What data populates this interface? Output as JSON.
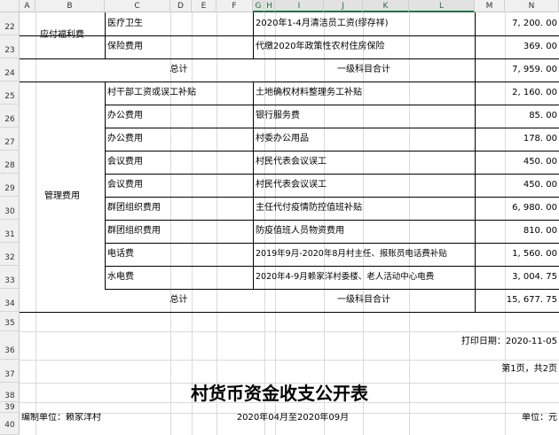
{
  "sheet": {
    "columns": [
      "A",
      "B",
      "C",
      "D",
      "E",
      "F",
      "G",
      "H",
      "I",
      "J",
      "K",
      "L",
      "M",
      "N"
    ],
    "rows": [
      "22",
      "23",
      "24",
      "25",
      "26",
      "27",
      "28",
      "29",
      "30",
      "31",
      "32",
      "33",
      "34",
      "35",
      "36",
      "37",
      "38",
      "39",
      "40"
    ]
  },
  "group1": {
    "category": "应付福利费",
    "items": [
      {
        "subject": "医疗卫生",
        "desc": "2020年1-4月清洁员工资(缪存祥)",
        "amount": "7, 200. 00"
      },
      {
        "subject": "保险费用",
        "desc": "代缴2020年政策性农村住房保险",
        "amount": "369. 00"
      }
    ],
    "total_label": "总计",
    "subtotal_label": "一级科目合计",
    "total_amount": "7, 959. 00"
  },
  "group2": {
    "category": "管理费用",
    "items": [
      {
        "subject": "村干部工资或误工补贴",
        "desc": "土地确权材料整理务工补贴",
        "amount": "2, 160. 00"
      },
      {
        "subject": "办公费用",
        "desc": "银行服务费",
        "amount": "85. 00"
      },
      {
        "subject": "办公费用",
        "desc": "村委办公用品",
        "amount": "178. 00"
      },
      {
        "subject": "会议费用",
        "desc": "村民代表会议误工",
        "amount": "450. 00"
      },
      {
        "subject": "会议费用",
        "desc": "村民代表会议误工",
        "amount": "450. 00"
      },
      {
        "subject": "群团组织费用",
        "desc": "主任代付疫情防控值班补贴",
        "amount": "6, 980. 00"
      },
      {
        "subject": "群团组织费用",
        "desc": "防疫值班人员物资费用",
        "amount": "810. 00"
      },
      {
        "subject": "电话费",
        "desc": "2019年9月-2020年8月村主任、报账员电话费补贴",
        "amount": "1, 560. 00"
      },
      {
        "subject": "水电费",
        "desc": "2020年4-9月赖家洋村委楼、老人活动中心电费",
        "amount": "3, 004. 75"
      }
    ],
    "total_label": "总计",
    "subtotal_label": "一级科目合计",
    "total_amount": "15, 677. 75"
  },
  "footer": {
    "print_date": "打印日期：2020-11-05",
    "page_info": "第1页，共2页",
    "report_title": "村货币资金收支公开表",
    "unit_name": "编制单位：赖家洋村",
    "period": "2020年04月至2020年09月",
    "currency_unit": "单位：元"
  }
}
